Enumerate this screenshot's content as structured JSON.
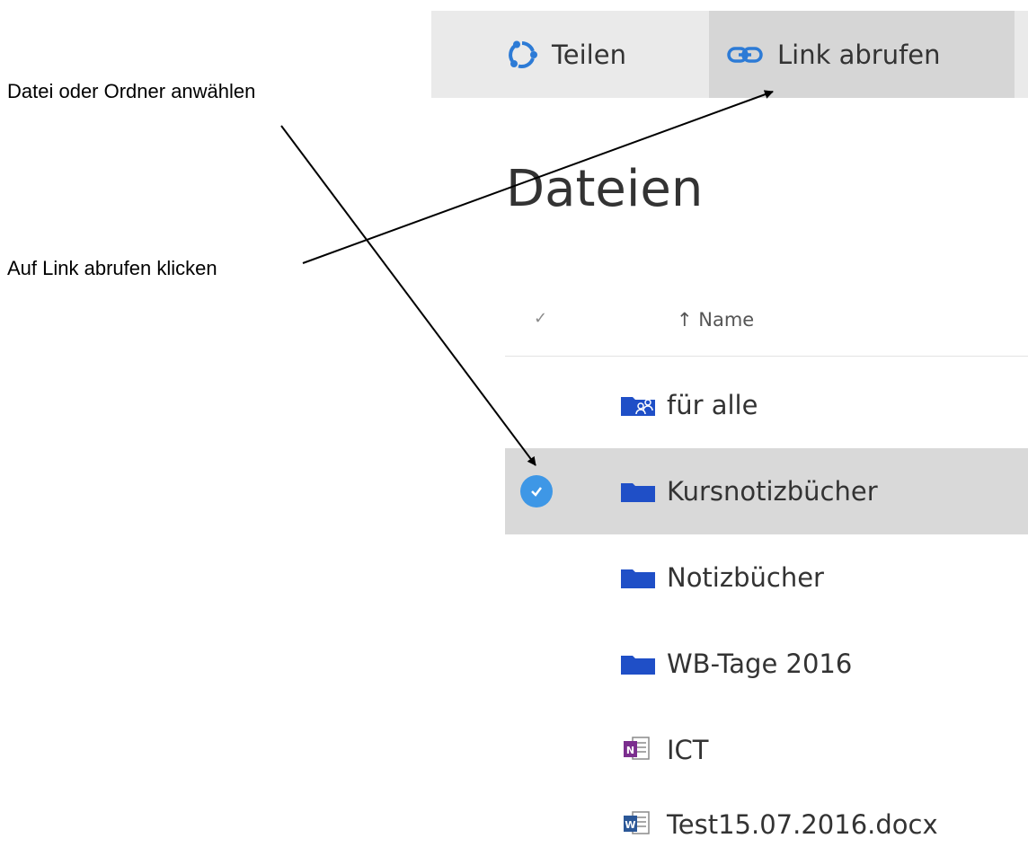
{
  "annotations": {
    "select_hint": "Datei oder Ordner anwählen",
    "click_hint": "Auf Link abrufen klicken"
  },
  "toolbar": {
    "share_label": "Teilen",
    "share_icon": "share-icon",
    "link_label": "Link abrufen",
    "link_icon": "link-icon"
  },
  "page": {
    "title": "Dateien"
  },
  "list": {
    "check_header": "✓",
    "name_header": "↑ Name",
    "items": [
      {
        "name": "für alle",
        "icon": "shared-folder-icon",
        "selected": false
      },
      {
        "name": "Kursnotizbücher",
        "icon": "folder-icon",
        "selected": true
      },
      {
        "name": "Notizbücher",
        "icon": "folder-icon",
        "selected": false
      },
      {
        "name": "WB-Tage 2016",
        "icon": "folder-icon",
        "selected": false
      },
      {
        "name": "ICT",
        "icon": "onenote-icon",
        "selected": false
      },
      {
        "name": "Test15.07.2016.docx",
        "icon": "word-document-icon",
        "selected": false
      }
    ]
  },
  "colors": {
    "toolbar_bg": "#eaeaea",
    "active_button_bg": "#d6d6d6",
    "selection_bg": "#d9d9d9",
    "check_blue": "#3e97e6",
    "folder_blue": "#1f4fc7",
    "onenote_purple": "#7b2e8e",
    "word_blue": "#2b5797"
  }
}
